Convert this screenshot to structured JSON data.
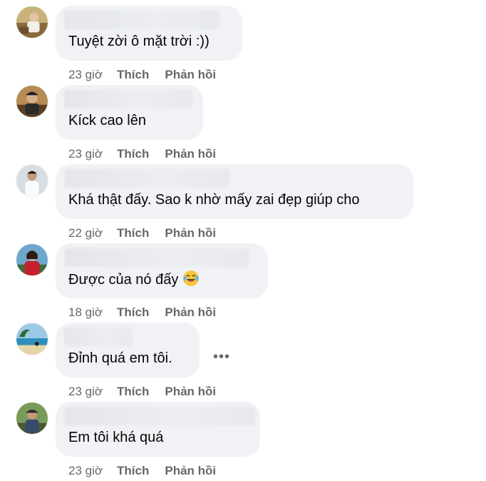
{
  "comments": [
    {
      "text": "Tuyệt zời ô mặt trời :))",
      "time": "23 giờ",
      "like": "Thích",
      "reply": "Phản hồi",
      "avatar": "avatar-boat"
    },
    {
      "text": "Kíck cao lên",
      "time": "23 giờ",
      "like": "Thích",
      "reply": "Phản hồi",
      "avatar": "avatar-man-cap"
    },
    {
      "text": "Khá thật đấy. Sao k nhờ mấy zai đẹp giúp cho",
      "time": "22 giờ",
      "like": "Thích",
      "reply": "Phản hồi",
      "avatar": "avatar-man-white"
    },
    {
      "text": "Được của nó đấy",
      "emoji": "tears-of-joy-emoji",
      "time": "18 giờ",
      "like": "Thích",
      "reply": "Phản hồi",
      "avatar": "avatar-woman-red"
    },
    {
      "text": "Đỉnh quá em tôi.",
      "time": "23 giờ",
      "like": "Thích",
      "reply": "Phản hồi",
      "avatar": "avatar-beach",
      "more_icon": "more-options-icon"
    },
    {
      "text": "Em tôi khá quá",
      "time": "23 giờ",
      "like": "Thích",
      "reply": "Phản hồi",
      "avatar": "avatar-man-outdoor"
    }
  ],
  "colors": {
    "bubble": "#f0f2f5",
    "meta": "#65676b",
    "text": "#050505"
  }
}
